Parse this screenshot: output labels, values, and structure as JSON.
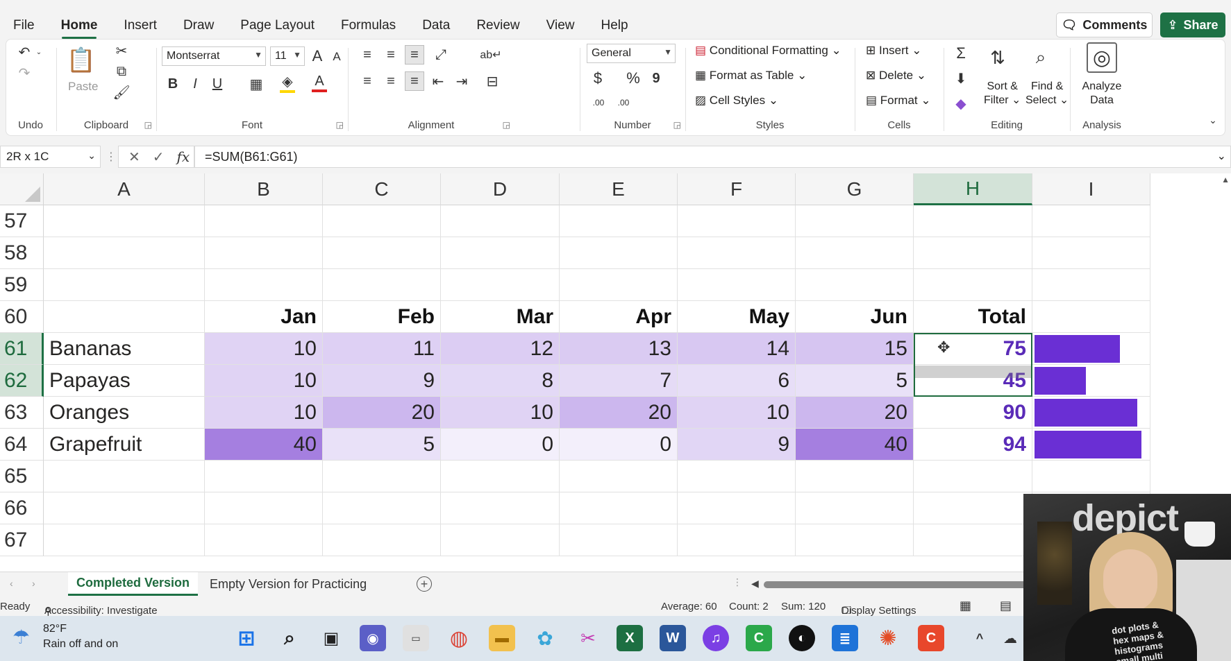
{
  "menu": {
    "tabs": [
      "File",
      "Home",
      "Insert",
      "Draw",
      "Page Layout",
      "Formulas",
      "Data",
      "Review",
      "View",
      "Help"
    ],
    "active": "Home",
    "comments_label": "Comments",
    "share_label": "Share"
  },
  "ribbon": {
    "undo": {
      "label": "Undo"
    },
    "clipboard": {
      "label": "Clipboard",
      "paste": "Paste"
    },
    "font": {
      "label": "Font",
      "name": "Montserrat",
      "size": "11",
      "bold": "B",
      "italic": "I",
      "underline": "U",
      "grow": "A",
      "shrink": "A",
      "fill_color": "#ffd700",
      "font_color": "#e02020",
      "font_glyph": "A"
    },
    "alignment": {
      "label": "Alignment"
    },
    "number": {
      "label": "Number",
      "format": "General",
      "currency": "$",
      "percent": "%",
      "comma": "9",
      "inc_decimal": ".00",
      "dec_decimal": ".00"
    },
    "styles": {
      "label": "Styles",
      "conditional": "Conditional Formatting",
      "format_table": "Format as Table",
      "cell_styles": "Cell Styles"
    },
    "cells": {
      "label": "Cells",
      "insert": "Insert",
      "delete": "Delete",
      "format": "Format"
    },
    "editing": {
      "label": "Editing",
      "sort_line1": "Sort &",
      "sort_line2": "Filter",
      "find_line1": "Find &",
      "find_line2": "Select"
    },
    "analysis": {
      "label": "Analysis",
      "analyze_line1": "Analyze",
      "analyze_line2": "Data"
    }
  },
  "formula_bar": {
    "name_box": "2R x 1C",
    "formula": "=SUM(B61:G61)",
    "fx": "fx"
  },
  "grid": {
    "columns": [
      "A",
      "B",
      "C",
      "D",
      "E",
      "F",
      "G",
      "H",
      "I"
    ],
    "selected_column": "H",
    "rows": [
      57,
      58,
      59,
      60,
      61,
      62,
      63,
      64,
      65,
      66,
      67
    ],
    "selected_rows": [
      61,
      62
    ],
    "headers": {
      "month_labels": [
        "Jan",
        "Feb",
        "Mar",
        "Apr",
        "May",
        "Jun"
      ],
      "total_label": "Total"
    },
    "data": [
      {
        "row": 61,
        "label": "Bananas",
        "values": [
          10,
          11,
          12,
          13,
          14,
          15
        ],
        "total": 75
      },
      {
        "row": 62,
        "label": "Papayas",
        "values": [
          10,
          9,
          8,
          7,
          6,
          5
        ],
        "total": 45
      },
      {
        "row": 63,
        "label": "Oranges",
        "values": [
          10,
          20,
          10,
          20,
          10,
          20
        ],
        "total": 90
      },
      {
        "row": 64,
        "label": "Grapefruit",
        "values": [
          40,
          5,
          0,
          0,
          9,
          40
        ],
        "total": 94
      }
    ],
    "heat_low": "#f3effb",
    "heat_high": "#a57fe0",
    "bar_color": "#6a2fd4",
    "bar_max": 100
  },
  "sheets": {
    "tabs": [
      "Completed Version",
      "Empty Version for Practicing"
    ],
    "active": "Completed Version"
  },
  "status": {
    "ready": "Ready",
    "accessibility": "Accessibility: Investigate",
    "average": "Average: 60",
    "count": "Count: 2",
    "sum": "Sum: 120",
    "display_settings": "Display Settings"
  },
  "taskbar": {
    "temp": "82°F",
    "weather": "Rain off and on"
  },
  "webcam": {
    "logo": "depict",
    "shirt_line1": "dot plots &",
    "shirt_line2": "hex maps &",
    "shirt_line3": "histograms",
    "shirt_line4": "small multi"
  }
}
